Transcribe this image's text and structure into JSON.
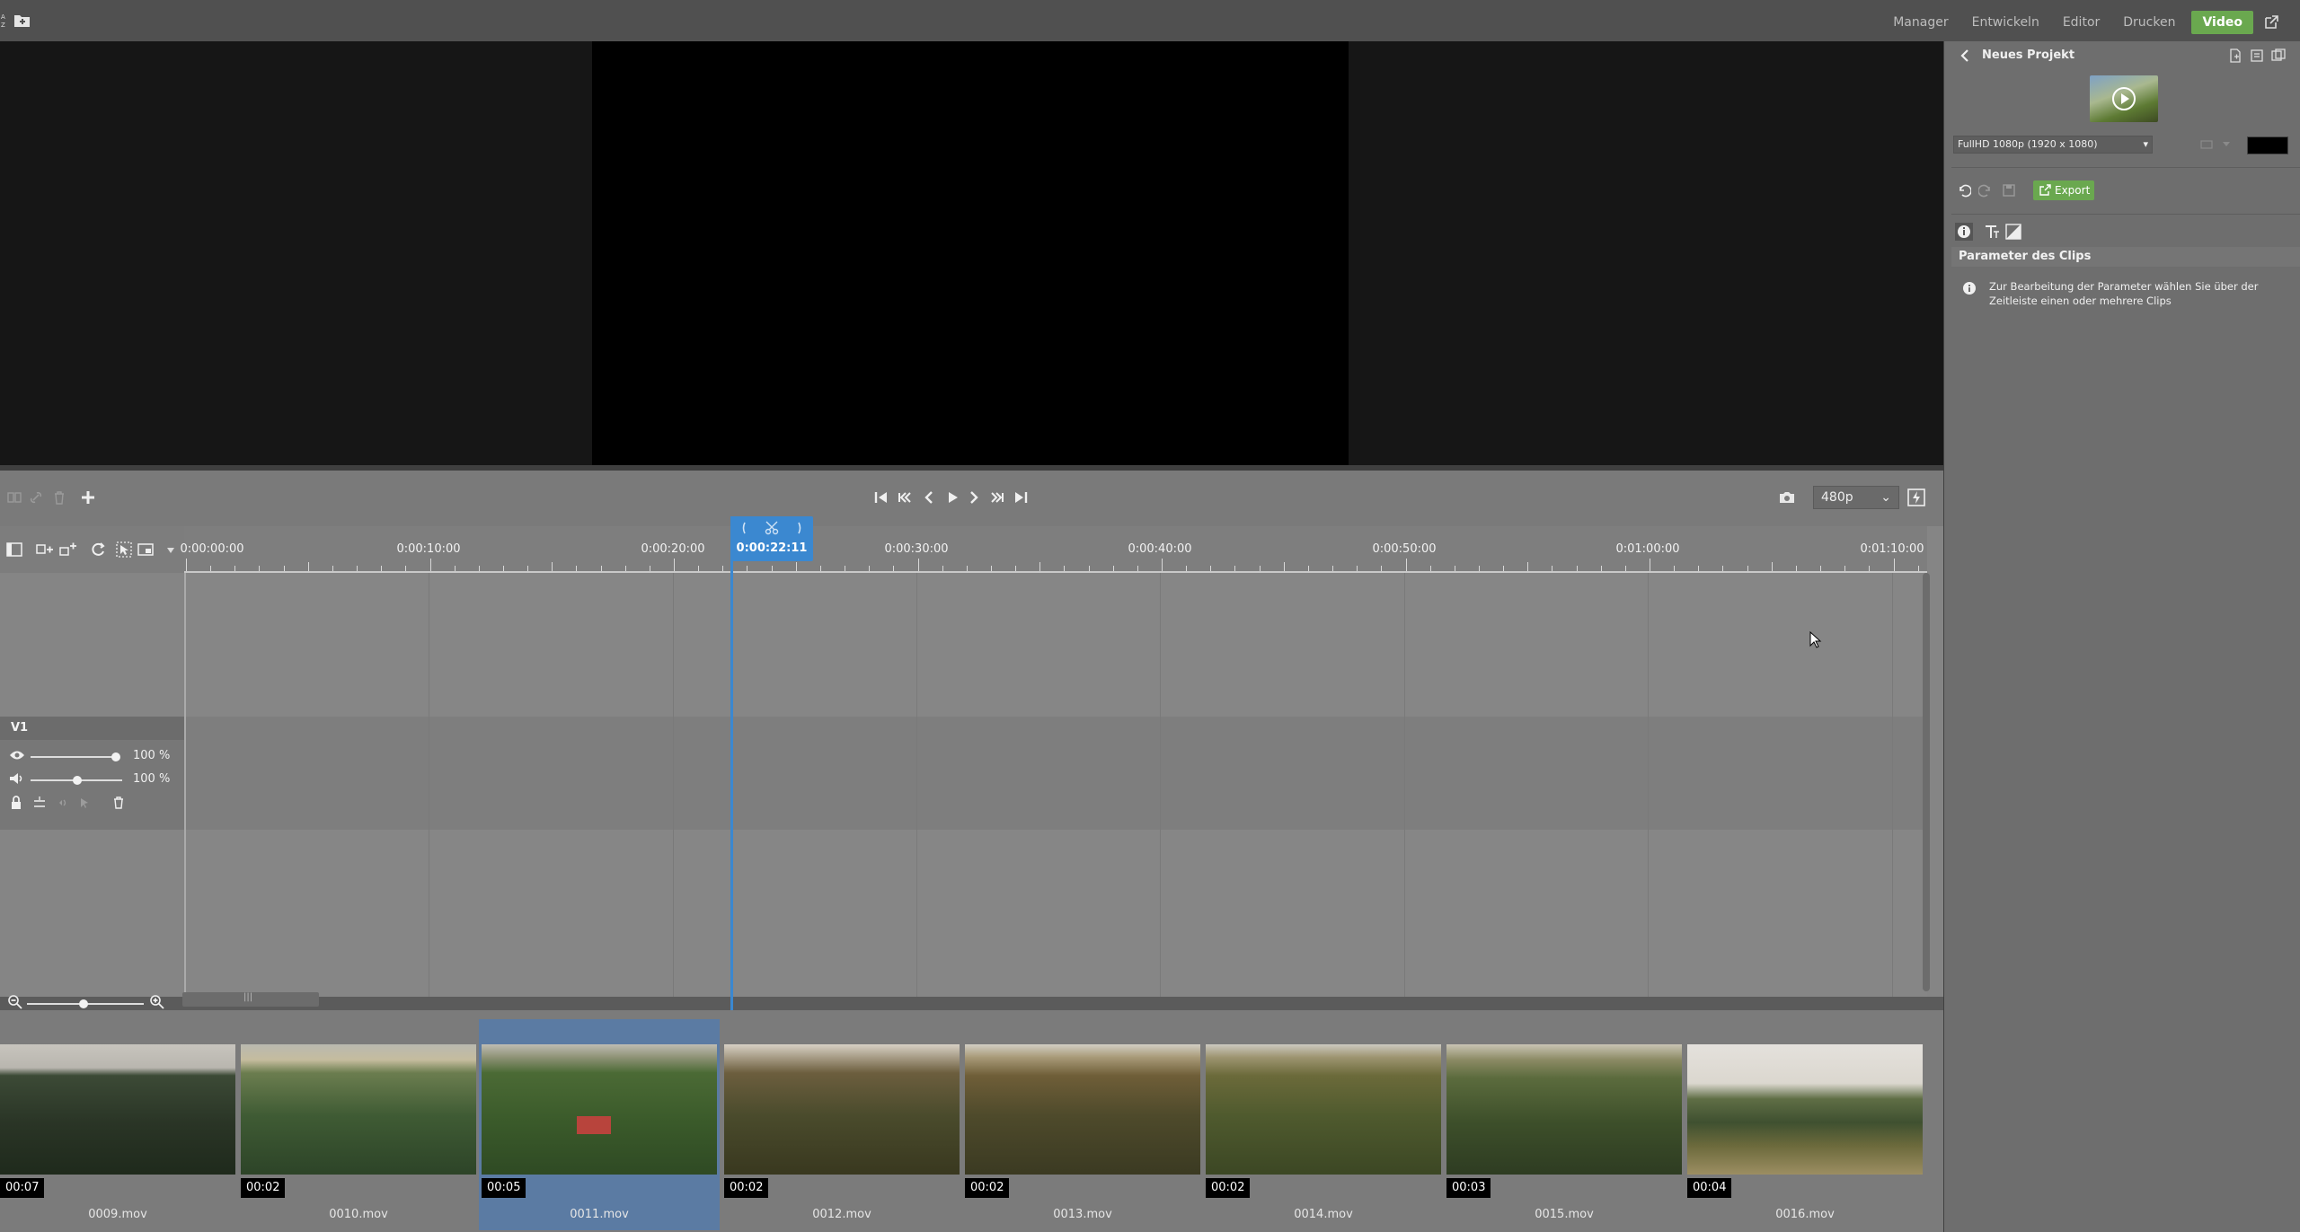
{
  "modules": {
    "tabs": [
      "Manager",
      "Entwickeln",
      "Editor",
      "Drucken",
      "Video"
    ],
    "active": "Video"
  },
  "colors": {
    "accent_green": "#6aa84f",
    "playhead_blue": "#3b88d0",
    "selection_blue": "#5b7ba3"
  },
  "transport": {
    "icons": [
      "go-to-start-icon",
      "previous-clip-icon",
      "previous-frame-icon",
      "play-icon",
      "next-frame-icon",
      "next-clip-icon",
      "go-to-end-icon"
    ],
    "quality": "480p"
  },
  "timeline": {
    "ruler_labels": [
      "0:00:00:00",
      "0:00:10:00",
      "0:00:20:00",
      "0:00:30:00",
      "0:00:40:00",
      "0:00:50:00",
      "0:01:00:00",
      "0:01:10:00"
    ],
    "playhead_time": "0:00:22:11",
    "track": {
      "name": "V1",
      "opacity": "100 %",
      "volume": "100 %"
    }
  },
  "clips": [
    {
      "duration": "00:07",
      "name": "0009.mov",
      "selected": false
    },
    {
      "duration": "00:02",
      "name": "0010.mov",
      "selected": false
    },
    {
      "duration": "00:05",
      "name": "0011.mov",
      "selected": true
    },
    {
      "duration": "00:02",
      "name": "0012.mov",
      "selected": false
    },
    {
      "duration": "00:02",
      "name": "0013.mov",
      "selected": false
    },
    {
      "duration": "00:02",
      "name": "0014.mov",
      "selected": false
    },
    {
      "duration": "00:03",
      "name": "0015.mov",
      "selected": false
    },
    {
      "duration": "00:04",
      "name": "0016.mov",
      "selected": false
    }
  ],
  "right_panel": {
    "project_title": "Neues Projekt",
    "format": "FullHD 1080p (1920 x 1080)",
    "export_label": "Export",
    "params_header": "Parameter des Clips",
    "info_text": "Zur Bearbeitung der Parameter wählen Sie über der Zeitleiste einen oder mehrere Clips"
  }
}
